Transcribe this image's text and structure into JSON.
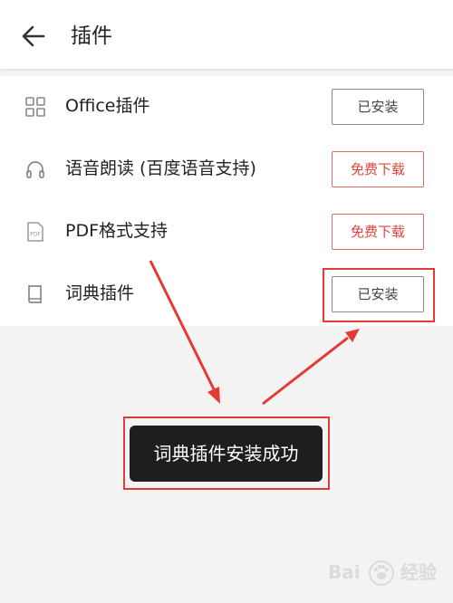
{
  "header": {
    "back_icon": "arrow-left-icon",
    "title": "插件"
  },
  "plugins": [
    {
      "icon": "office-icon",
      "label": "Office插件",
      "button": "已安装",
      "status": "installed"
    },
    {
      "icon": "headphones-icon",
      "label": "语音朗读 (百度语音支持)",
      "button": "免费下载",
      "status": "free"
    },
    {
      "icon": "pdf-icon",
      "label": "PDF格式支持",
      "icon_text": "PDF",
      "button": "免费下载",
      "status": "free"
    },
    {
      "icon": "book-icon",
      "label": "词典插件",
      "button": "已安装",
      "status": "installed"
    }
  ],
  "toast": {
    "text": "词典插件安装成功"
  },
  "watermark": {
    "text_left": "Bai",
    "text_right": "经验",
    "icon": "paw-icon"
  },
  "colors": {
    "accent_red": "#e0443b",
    "annotation_red": "#e53935",
    "toast_bg": "#1e1e1e",
    "page_bg": "#f3f3f3"
  }
}
